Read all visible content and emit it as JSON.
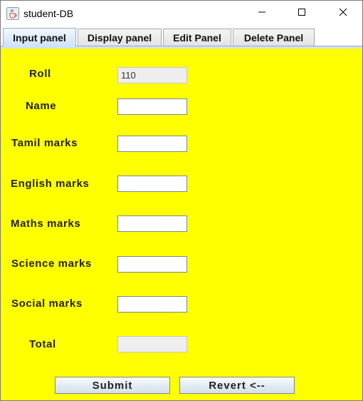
{
  "window": {
    "title": "student-DB",
    "icon": "java-cup-icon",
    "controls": [
      "minimize",
      "maximize",
      "close"
    ]
  },
  "tabs": [
    {
      "label": "Input panel",
      "active": true
    },
    {
      "label": "Display panel",
      "active": false
    },
    {
      "label": "Edit Panel",
      "active": false
    },
    {
      "label": "Delete Panel",
      "active": false
    }
  ],
  "form": {
    "roll": {
      "label": "Roll",
      "value": "110"
    },
    "name": {
      "label": "Name",
      "value": ""
    },
    "tamil": {
      "label": "Tamil marks",
      "value": ""
    },
    "english": {
      "label": "English marks",
      "value": ""
    },
    "maths": {
      "label": "Maths marks",
      "value": ""
    },
    "science": {
      "label": "Science marks",
      "value": ""
    },
    "social": {
      "label": "Social marks",
      "value": ""
    },
    "total": {
      "label": "Total",
      "value": ""
    }
  },
  "buttons": {
    "submit": "Submit",
    "revert": "Revert <--"
  },
  "colors": {
    "panel_background": "#ffff00",
    "active_tab": "#cfe2f7"
  }
}
